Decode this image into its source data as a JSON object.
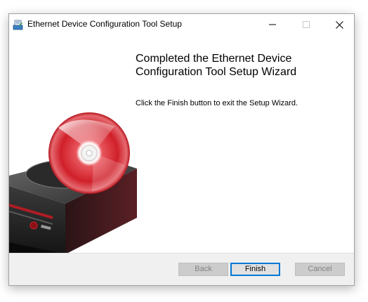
{
  "window": {
    "title": "Ethernet Device Configuration Tool Setup",
    "icon": "installer-icon",
    "controls": [
      "minimize-icon",
      "maximize-icon",
      "close-icon"
    ]
  },
  "main": {
    "heading_line1": "Completed the Ethernet Device",
    "heading_line2": "Configuration Tool Setup Wizard",
    "message": "Click the Finish button to exit the Setup Wizard.",
    "graphic": "cd-drive-disc-image"
  },
  "footer": {
    "back_label": "Back",
    "finish_label": "Finish",
    "cancel_label": "Cancel",
    "back_enabled": false,
    "finish_enabled": true,
    "cancel_enabled": false
  },
  "colors": {
    "accent": "#0078d7",
    "footer_bg": "#f0f0f0",
    "disabled_button": "#cccccc",
    "disabled_text": "#838383",
    "disc_red": "#d0202a"
  }
}
